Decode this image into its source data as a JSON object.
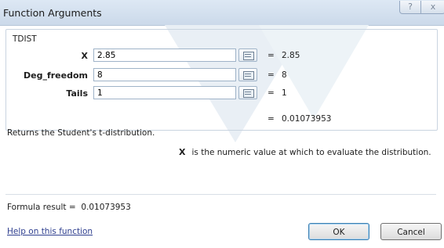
{
  "window": {
    "title": "Function Arguments",
    "help_glyph": "?",
    "close_glyph": "x"
  },
  "function": {
    "name": "TDIST"
  },
  "arguments": [
    {
      "label": "X",
      "value": "2.85",
      "evaluated": "2.85"
    },
    {
      "label": "Deg_freedom",
      "value": "8",
      "evaluated": "8"
    },
    {
      "label": "Tails",
      "value": "1",
      "evaluated": "1"
    }
  ],
  "equals": "=",
  "result": {
    "value": "0.01073953"
  },
  "description": "Returns the Student's t-distribution.",
  "arg_description": {
    "name": "X",
    "text": "is the numeric value at which to evaluate the distribution."
  },
  "formula_result": {
    "label": "Formula result =",
    "value": "0.01073953"
  },
  "help_link": "Help on this function",
  "buttons": {
    "ok": "OK",
    "cancel": "Cancel"
  },
  "icons": {
    "collapse_dialog": "collapse-dialog-icon"
  }
}
